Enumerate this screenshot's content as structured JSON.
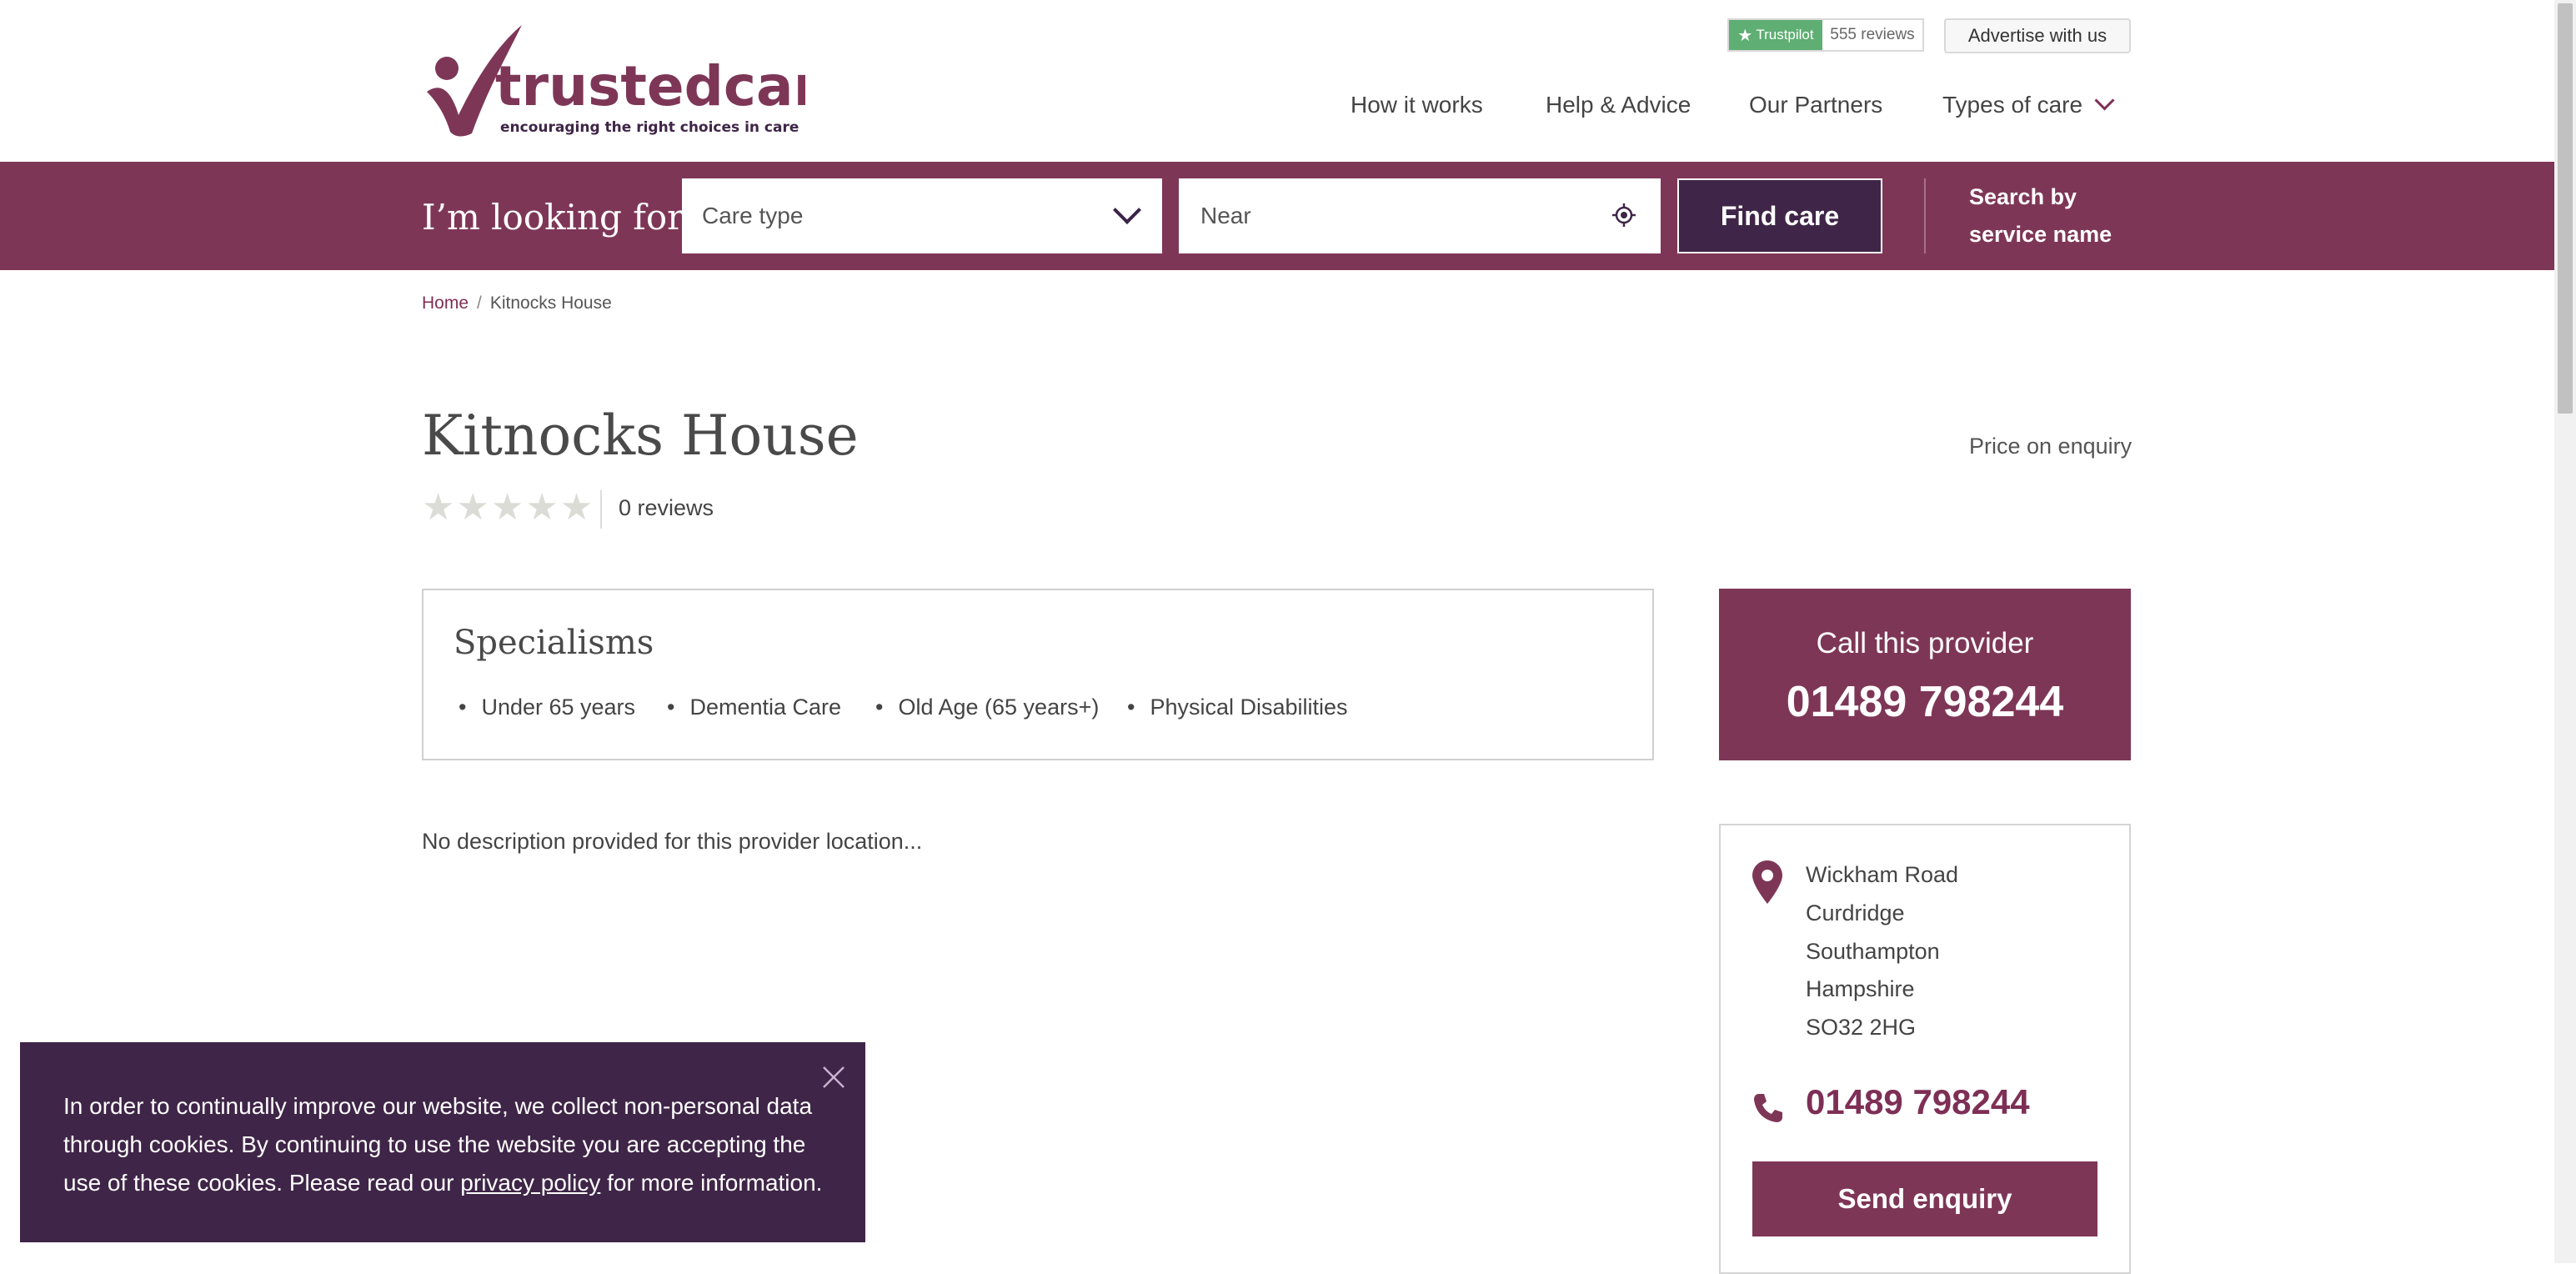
{
  "header": {
    "logo": {
      "brand": "trustedcare",
      "tagline": "encouraging the right choices in care"
    },
    "trustpilot": {
      "label": "Trustpilot",
      "reviews": "555 reviews"
    },
    "advertise_label": "Advertise with us",
    "nav": [
      {
        "label": "How it works"
      },
      {
        "label": "Help & Advice"
      },
      {
        "label": "Our Partners"
      },
      {
        "label": "Types of care"
      }
    ]
  },
  "search": {
    "heading": "I’m looking for",
    "care_type_placeholder": "Care type",
    "near_placeholder": "Near",
    "find_label": "Find care",
    "search_by_name": "Search by service name"
  },
  "breadcrumb": {
    "home": "Home",
    "separator": "/",
    "current": "Kitnocks House"
  },
  "provider": {
    "name": "Kitnocks House",
    "price": "Price on enquiry",
    "rating": 0,
    "reviews": "0 reviews",
    "specialisms_title": "Specialisms",
    "specialisms": [
      "Under 65 years",
      "Dementia Care",
      "Old Age (65 years+)",
      "Physical Disabilities"
    ],
    "description": "No description provided for this provider location...",
    "call_label": "Call this provider",
    "phone": "01489 798244",
    "address": [
      "Wickham Road",
      "Curdridge",
      "Southampton",
      "Hampshire",
      "SO32 2HG"
    ],
    "send_enquiry": "Send enquiry"
  },
  "cookie": {
    "text_before": "In order to continually improve our website, we collect non-personal data through cookies. By continuing to use the website you are accepting the use of these cookies. Please read our ",
    "link": "privacy policy",
    "text_after": " for more information."
  },
  "colors": {
    "brand": "#7e3657",
    "dark": "#3f2547",
    "trustpilot": "#5fae73"
  }
}
